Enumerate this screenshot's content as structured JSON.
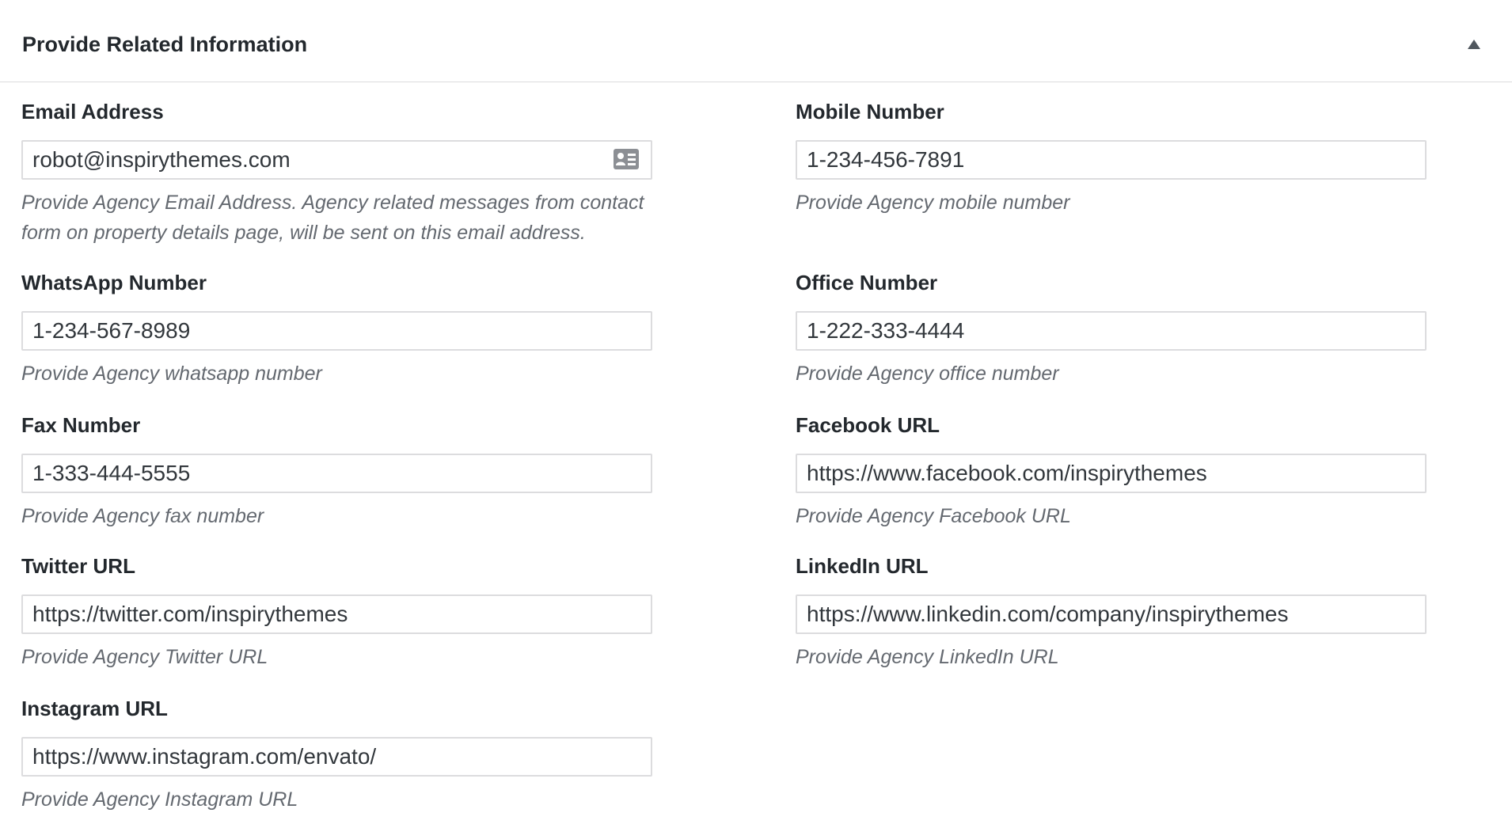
{
  "panel": {
    "title": "Provide Related Information",
    "toggle_icon": "triangle-up-icon"
  },
  "fields": {
    "email": {
      "label": "Email Address",
      "value": "robot@inspirythemes.com",
      "icon": "contact-card-icon",
      "description": "Provide Agency Email Address. Agency related messages from contact form on property details page, will be sent on this email address."
    },
    "mobile": {
      "label": "Mobile Number",
      "value": "1-234-456-7891",
      "description": "Provide Agency mobile number"
    },
    "whatsapp": {
      "label": "WhatsApp Number",
      "value": "1-234-567-8989",
      "description": "Provide Agency whatsapp number"
    },
    "office": {
      "label": "Office Number",
      "value": "1-222-333-4444",
      "description": "Provide Agency office number"
    },
    "fax": {
      "label": "Fax Number",
      "value": "1-333-444-5555",
      "description": "Provide Agency fax number"
    },
    "facebook": {
      "label": "Facebook URL",
      "value": "https://www.facebook.com/inspirythemes",
      "description": "Provide Agency Facebook URL"
    },
    "twitter": {
      "label": "Twitter URL",
      "value": "https://twitter.com/inspirythemes",
      "description": "Provide Agency Twitter URL"
    },
    "linkedin": {
      "label": "LinkedIn URL",
      "value": "https://www.linkedin.com/company/inspirythemes",
      "description": "Provide Agency LinkedIn URL"
    },
    "instagram": {
      "label": "Instagram URL",
      "value": "https://www.instagram.com/envato/",
      "description": "Provide Agency Instagram URL"
    }
  }
}
